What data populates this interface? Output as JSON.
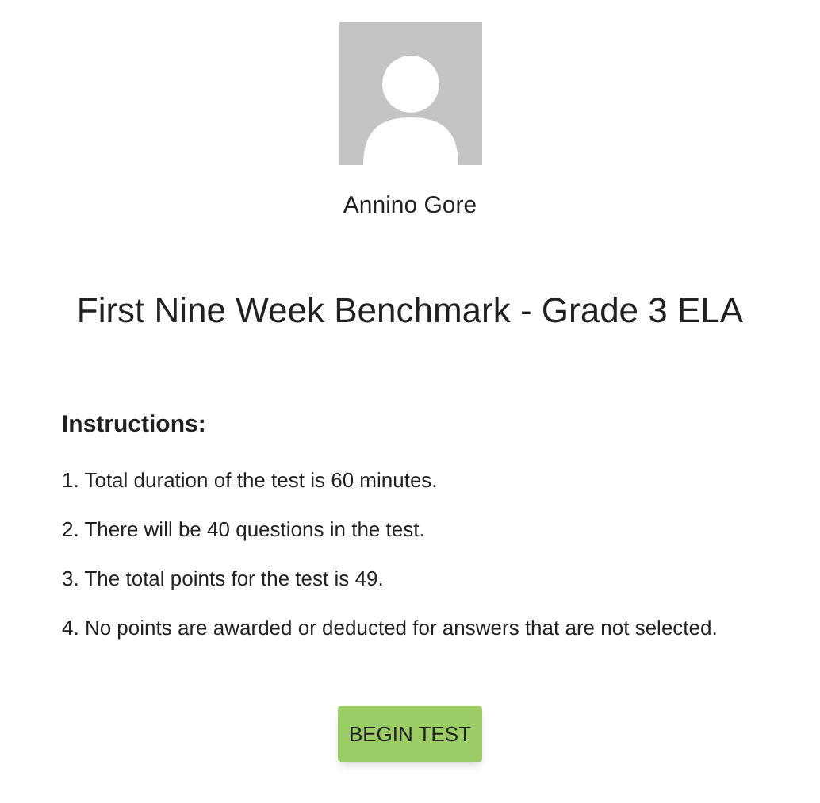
{
  "user": {
    "name": "Annino Gore"
  },
  "test": {
    "title": "First Nine Week Benchmark - Grade 3 ELA"
  },
  "instructions": {
    "heading": "Instructions:",
    "items": [
      "1. Total duration of the test is 60 minutes.",
      "2. There will be 40 questions in the test.",
      "3. The total points for the test is 49.",
      "4. No points are awarded or deducted for answers that are not selected."
    ]
  },
  "button": {
    "label": "BEGIN TEST"
  }
}
